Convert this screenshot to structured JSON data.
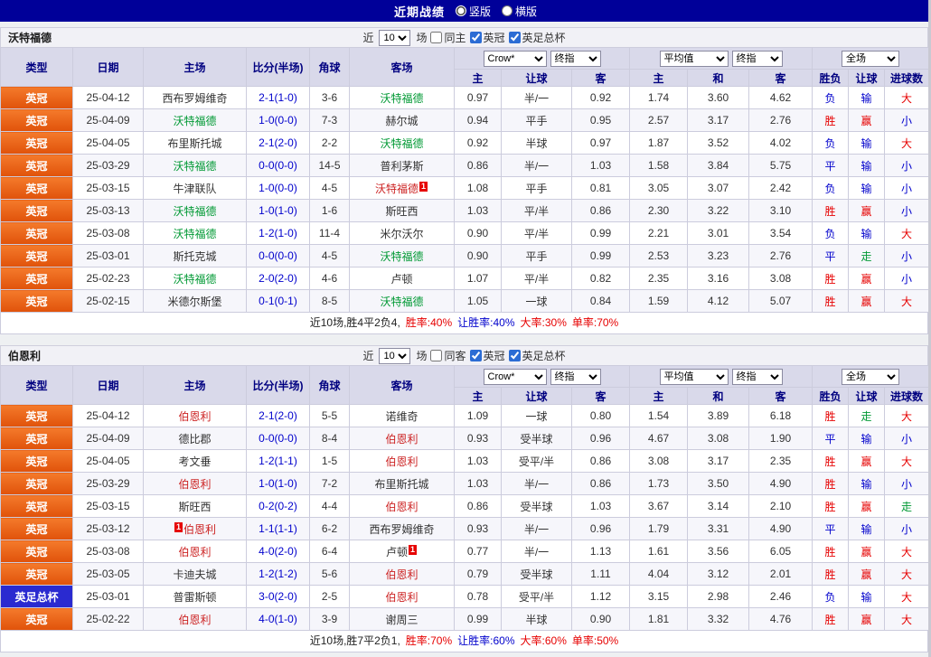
{
  "colors": {
    "topbar_bg": "#000099",
    "header_bg": "#d9d9ea",
    "header_text": "#000080",
    "type_league_bg": "#e8570f",
    "type_cup_bg": "#2a2ad0",
    "team_green": "#019934",
    "team_red": "#cc2222",
    "score_blue": "#0000cc",
    "win_red": "#e60000",
    "lose_blue": "#0000cc",
    "push_green": "#019934"
  },
  "topbar": {
    "title": "近期战绩",
    "radios": [
      {
        "label": "竖版",
        "selected": true
      },
      {
        "label": "横版",
        "selected": false
      }
    ]
  },
  "table_header": {
    "left_cols": [
      "类型",
      "日期",
      "主场",
      "比分(半场)",
      "角球",
      "客场"
    ],
    "odds_selects": [
      "Crow*",
      "终指"
    ],
    "odds_cols": [
      "主",
      "让球",
      "客"
    ],
    "avg_selects": [
      "平均值",
      "终指"
    ],
    "avg_cols": [
      "主",
      "和",
      "客"
    ],
    "scope_select": "全场",
    "result_cols": [
      "胜负",
      "让球",
      "进球数"
    ]
  },
  "sections": [
    {
      "team": "沃特福德",
      "controls": {
        "prefix": "近",
        "count": "10",
        "suffix": "场",
        "checkboxes": [
          {
            "label": "同主",
            "checked": false
          },
          {
            "label": "英冠",
            "checked": true
          },
          {
            "label": "英足总杯",
            "checked": true
          }
        ]
      },
      "rows": [
        {
          "type": "英冠",
          "cup": false,
          "date": "25-04-12",
          "home": {
            "n": "西布罗姆维奇",
            "c": "black"
          },
          "score": "2-1(1-0)",
          "corner": "3-6",
          "away": {
            "n": "沃特福德",
            "c": "green"
          },
          "odds": [
            "0.97",
            "半/一",
            "0.92"
          ],
          "avg": [
            "1.74",
            "3.60",
            "4.62"
          ],
          "res": [
            [
              "负",
              "blue"
            ],
            [
              "输",
              "blue"
            ],
            [
              "大",
              "red"
            ]
          ]
        },
        {
          "type": "英冠",
          "cup": false,
          "date": "25-04-09",
          "home": {
            "n": "沃特福德",
            "c": "green"
          },
          "score": "1-0(0-0)",
          "corner": "7-3",
          "away": {
            "n": "赫尔城",
            "c": "black"
          },
          "odds": [
            "0.94",
            "平手",
            "0.95"
          ],
          "avg": [
            "2.57",
            "3.17",
            "2.76"
          ],
          "res": [
            [
              "胜",
              "red"
            ],
            [
              "赢",
              "red"
            ],
            [
              "小",
              "blue"
            ]
          ]
        },
        {
          "type": "英冠",
          "cup": false,
          "date": "25-04-05",
          "home": {
            "n": "布里斯托城",
            "c": "black"
          },
          "score": "2-1(2-0)",
          "corner": "2-2",
          "away": {
            "n": "沃特福德",
            "c": "green"
          },
          "odds": [
            "0.92",
            "半球",
            "0.97"
          ],
          "avg": [
            "1.87",
            "3.52",
            "4.02"
          ],
          "res": [
            [
              "负",
              "blue"
            ],
            [
              "输",
              "blue"
            ],
            [
              "大",
              "red"
            ]
          ]
        },
        {
          "type": "英冠",
          "cup": false,
          "date": "25-03-29",
          "home": {
            "n": "沃特福德",
            "c": "green"
          },
          "score": "0-0(0-0)",
          "corner": "14-5",
          "away": {
            "n": "普利茅斯",
            "c": "black"
          },
          "odds": [
            "0.86",
            "半/一",
            "1.03"
          ],
          "avg": [
            "1.58",
            "3.84",
            "5.75"
          ],
          "res": [
            [
              "平",
              "blue"
            ],
            [
              "输",
              "blue"
            ],
            [
              "小",
              "blue"
            ]
          ]
        },
        {
          "type": "英冠",
          "cup": false,
          "date": "25-03-15",
          "home": {
            "n": "牛津联队",
            "c": "black"
          },
          "score": "1-0(0-0)",
          "corner": "4-5",
          "away": {
            "n": "沃特福德",
            "c": "red",
            "b": "1",
            "bp": "after"
          },
          "odds": [
            "1.08",
            "平手",
            "0.81"
          ],
          "avg": [
            "3.05",
            "3.07",
            "2.42"
          ],
          "res": [
            [
              "负",
              "blue"
            ],
            [
              "输",
              "blue"
            ],
            [
              "小",
              "blue"
            ]
          ]
        },
        {
          "type": "英冠",
          "cup": false,
          "date": "25-03-13",
          "home": {
            "n": "沃特福德",
            "c": "green"
          },
          "score": "1-0(1-0)",
          "corner": "1-6",
          "away": {
            "n": "斯旺西",
            "c": "black"
          },
          "odds": [
            "1.03",
            "平/半",
            "0.86"
          ],
          "avg": [
            "2.30",
            "3.22",
            "3.10"
          ],
          "res": [
            [
              "胜",
              "red"
            ],
            [
              "赢",
              "red"
            ],
            [
              "小",
              "blue"
            ]
          ]
        },
        {
          "type": "英冠",
          "cup": false,
          "date": "25-03-08",
          "home": {
            "n": "沃特福德",
            "c": "green"
          },
          "score": "1-2(1-0)",
          "corner": "11-4",
          "away": {
            "n": "米尔沃尔",
            "c": "black"
          },
          "odds": [
            "0.90",
            "平/半",
            "0.99"
          ],
          "avg": [
            "2.21",
            "3.01",
            "3.54"
          ],
          "res": [
            [
              "负",
              "blue"
            ],
            [
              "输",
              "blue"
            ],
            [
              "大",
              "red"
            ]
          ]
        },
        {
          "type": "英冠",
          "cup": false,
          "date": "25-03-01",
          "home": {
            "n": "斯托克城",
            "c": "black"
          },
          "score": "0-0(0-0)",
          "corner": "4-5",
          "away": {
            "n": "沃特福德",
            "c": "green"
          },
          "odds": [
            "0.90",
            "平手",
            "0.99"
          ],
          "avg": [
            "2.53",
            "3.23",
            "2.76"
          ],
          "res": [
            [
              "平",
              "blue"
            ],
            [
              "走",
              "green"
            ],
            [
              "小",
              "blue"
            ]
          ]
        },
        {
          "type": "英冠",
          "cup": false,
          "date": "25-02-23",
          "home": {
            "n": "沃特福德",
            "c": "green"
          },
          "score": "2-0(2-0)",
          "corner": "4-6",
          "away": {
            "n": "卢顿",
            "c": "black"
          },
          "odds": [
            "1.07",
            "平/半",
            "0.82"
          ],
          "avg": [
            "2.35",
            "3.16",
            "3.08"
          ],
          "res": [
            [
              "胜",
              "red"
            ],
            [
              "赢",
              "red"
            ],
            [
              "小",
              "blue"
            ]
          ]
        },
        {
          "type": "英冠",
          "cup": false,
          "date": "25-02-15",
          "home": {
            "n": "米德尔斯堡",
            "c": "black"
          },
          "score": "0-1(0-1)",
          "corner": "8-5",
          "away": {
            "n": "沃特福德",
            "c": "green"
          },
          "odds": [
            "1.05",
            "一球",
            "0.84"
          ],
          "avg": [
            "1.59",
            "4.12",
            "5.07"
          ],
          "res": [
            [
              "胜",
              "red"
            ],
            [
              "赢",
              "red"
            ],
            [
              "大",
              "red"
            ]
          ]
        }
      ],
      "summary": [
        {
          "t": "近10场,胜4平2负4,",
          "c": "black"
        },
        {
          "t": "胜率:40%",
          "c": "red"
        },
        {
          "t": "让胜率:40%",
          "c": "blue"
        },
        {
          "t": "大率:30%",
          "c": "red"
        },
        {
          "t": "单率:70%",
          "c": "red"
        }
      ]
    },
    {
      "team": "伯恩利",
      "controls": {
        "prefix": "近",
        "count": "10",
        "suffix": "场",
        "checkboxes": [
          {
            "label": "同客",
            "checked": false
          },
          {
            "label": "英冠",
            "checked": true
          },
          {
            "label": "英足总杯",
            "checked": true
          }
        ]
      },
      "rows": [
        {
          "type": "英冠",
          "cup": false,
          "date": "25-04-12",
          "home": {
            "n": "伯恩利",
            "c": "red"
          },
          "score": "2-1(2-0)",
          "corner": "5-5",
          "away": {
            "n": "诺维奇",
            "c": "black"
          },
          "odds": [
            "1.09",
            "一球",
            "0.80"
          ],
          "avg": [
            "1.54",
            "3.89",
            "6.18"
          ],
          "res": [
            [
              "胜",
              "red"
            ],
            [
              "走",
              "green"
            ],
            [
              "大",
              "red"
            ]
          ]
        },
        {
          "type": "英冠",
          "cup": false,
          "date": "25-04-09",
          "home": {
            "n": "德比郡",
            "c": "black"
          },
          "score": "0-0(0-0)",
          "corner": "8-4",
          "away": {
            "n": "伯恩利",
            "c": "red"
          },
          "odds": [
            "0.93",
            "受半球",
            "0.96"
          ],
          "avg": [
            "4.67",
            "3.08",
            "1.90"
          ],
          "res": [
            [
              "平",
              "blue"
            ],
            [
              "输",
              "blue"
            ],
            [
              "小",
              "blue"
            ]
          ]
        },
        {
          "type": "英冠",
          "cup": false,
          "date": "25-04-05",
          "home": {
            "n": "考文垂",
            "c": "black"
          },
          "score": "1-2(1-1)",
          "corner": "1-5",
          "away": {
            "n": "伯恩利",
            "c": "red"
          },
          "odds": [
            "1.03",
            "受平/半",
            "0.86"
          ],
          "avg": [
            "3.08",
            "3.17",
            "2.35"
          ],
          "res": [
            [
              "胜",
              "red"
            ],
            [
              "赢",
              "red"
            ],
            [
              "大",
              "red"
            ]
          ]
        },
        {
          "type": "英冠",
          "cup": false,
          "date": "25-03-29",
          "home": {
            "n": "伯恩利",
            "c": "red"
          },
          "score": "1-0(1-0)",
          "corner": "7-2",
          "away": {
            "n": "布里斯托城",
            "c": "black"
          },
          "odds": [
            "1.03",
            "半/一",
            "0.86"
          ],
          "avg": [
            "1.73",
            "3.50",
            "4.90"
          ],
          "res": [
            [
              "胜",
              "red"
            ],
            [
              "输",
              "blue"
            ],
            [
              "小",
              "blue"
            ]
          ]
        },
        {
          "type": "英冠",
          "cup": false,
          "date": "25-03-15",
          "home": {
            "n": "斯旺西",
            "c": "black"
          },
          "score": "0-2(0-2)",
          "corner": "4-4",
          "away": {
            "n": "伯恩利",
            "c": "red"
          },
          "odds": [
            "0.86",
            "受半球",
            "1.03"
          ],
          "avg": [
            "3.67",
            "3.14",
            "2.10"
          ],
          "res": [
            [
              "胜",
              "red"
            ],
            [
              "赢",
              "red"
            ],
            [
              "走",
              "green"
            ]
          ]
        },
        {
          "type": "英冠",
          "cup": false,
          "date": "25-03-12",
          "home": {
            "n": "伯恩利",
            "c": "red",
            "b": "1",
            "bp": "before"
          },
          "score": "1-1(1-1)",
          "corner": "6-2",
          "away": {
            "n": "西布罗姆维奇",
            "c": "black"
          },
          "odds": [
            "0.93",
            "半/一",
            "0.96"
          ],
          "avg": [
            "1.79",
            "3.31",
            "4.90"
          ],
          "res": [
            [
              "平",
              "blue"
            ],
            [
              "输",
              "blue"
            ],
            [
              "小",
              "blue"
            ]
          ]
        },
        {
          "type": "英冠",
          "cup": false,
          "date": "25-03-08",
          "home": {
            "n": "伯恩利",
            "c": "red"
          },
          "score": "4-0(2-0)",
          "corner": "6-4",
          "away": {
            "n": "卢顿",
            "c": "black",
            "b": "1",
            "bp": "after"
          },
          "odds": [
            "0.77",
            "半/一",
            "1.13"
          ],
          "avg": [
            "1.61",
            "3.56",
            "6.05"
          ],
          "res": [
            [
              "胜",
              "red"
            ],
            [
              "赢",
              "red"
            ],
            [
              "大",
              "red"
            ]
          ]
        },
        {
          "type": "英冠",
          "cup": false,
          "date": "25-03-05",
          "home": {
            "n": "卡迪夫城",
            "c": "black"
          },
          "score": "1-2(1-2)",
          "corner": "5-6",
          "away": {
            "n": "伯恩利",
            "c": "red"
          },
          "odds": [
            "0.79",
            "受半球",
            "1.11"
          ],
          "avg": [
            "4.04",
            "3.12",
            "2.01"
          ],
          "res": [
            [
              "胜",
              "red"
            ],
            [
              "赢",
              "red"
            ],
            [
              "大",
              "red"
            ]
          ]
        },
        {
          "type": "英足总杯",
          "cup": true,
          "date": "25-03-01",
          "home": {
            "n": "普雷斯顿",
            "c": "black"
          },
          "score": "3-0(2-0)",
          "corner": "2-5",
          "away": {
            "n": "伯恩利",
            "c": "red"
          },
          "odds": [
            "0.78",
            "受平/半",
            "1.12"
          ],
          "avg": [
            "3.15",
            "2.98",
            "2.46"
          ],
          "res": [
            [
              "负",
              "blue"
            ],
            [
              "输",
              "blue"
            ],
            [
              "大",
              "red"
            ]
          ]
        },
        {
          "type": "英冠",
          "cup": false,
          "date": "25-02-22",
          "home": {
            "n": "伯恩利",
            "c": "red"
          },
          "score": "4-0(1-0)",
          "corner": "3-9",
          "away": {
            "n": "谢周三",
            "c": "black"
          },
          "odds": [
            "0.99",
            "半球",
            "0.90"
          ],
          "avg": [
            "1.81",
            "3.32",
            "4.76"
          ],
          "res": [
            [
              "胜",
              "red"
            ],
            [
              "赢",
              "red"
            ],
            [
              "大",
              "red"
            ]
          ]
        }
      ],
      "summary": [
        {
          "t": "近10场,胜7平2负1,",
          "c": "black"
        },
        {
          "t": "胜率:70%",
          "c": "red"
        },
        {
          "t": "让胜率:60%",
          "c": "blue"
        },
        {
          "t": "大率:60%",
          "c": "red"
        },
        {
          "t": "单率:50%",
          "c": "red"
        }
      ]
    }
  ]
}
